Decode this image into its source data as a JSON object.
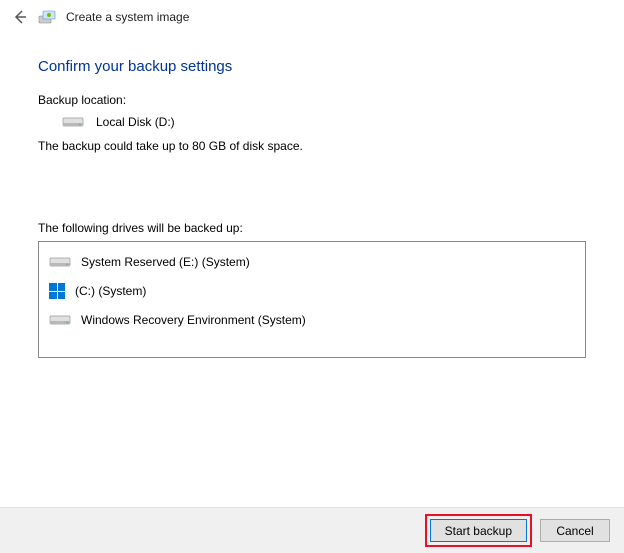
{
  "titlebar": {
    "title": "Create a system image"
  },
  "heading": "Confirm your backup settings",
  "backup_location_label": "Backup location:",
  "backup_location_value": "Local Disk (D:)",
  "size_note": "The backup could take up to 80 GB of disk space.",
  "drives_label": "The following drives will be backed up:",
  "drives": [
    {
      "icon": "disk",
      "label": "System Reserved (E:) (System)"
    },
    {
      "icon": "windows",
      "label": "(C:) (System)"
    },
    {
      "icon": "disk",
      "label": "Windows Recovery Environment (System)"
    }
  ],
  "buttons": {
    "start": "Start backup",
    "cancel": "Cancel"
  }
}
